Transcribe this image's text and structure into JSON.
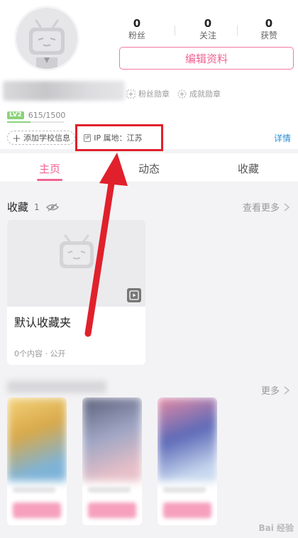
{
  "stats": [
    {
      "value": "0",
      "label": "粉丝"
    },
    {
      "value": "0",
      "label": "关注"
    },
    {
      "value": "0",
      "label": "获赞"
    }
  ],
  "edit_profile_label": "编辑资料",
  "medals": {
    "fans": "粉丝勋章",
    "achievements": "成就勋章"
  },
  "level": {
    "badge": "LV2",
    "exp": "615/1500",
    "progress": 0.41
  },
  "school_tag": "添加学校信息",
  "ip": {
    "icon_text": "IP",
    "label": "IP 属地：江苏"
  },
  "detail_link": "详情",
  "tabs": [
    {
      "label": "主页",
      "active": true
    },
    {
      "label": "动态",
      "active": false
    },
    {
      "label": "收藏",
      "active": false
    }
  ],
  "favorites": {
    "title": "收藏",
    "count": "1",
    "see_more": "查看更多",
    "card": {
      "name": "默认收藏夹",
      "meta": "0个内容 · 公开"
    }
  },
  "second_section": {
    "more": "更多"
  },
  "watermark": "Bai 经验",
  "colors": {
    "accent": "#f06292",
    "link": "#2a8fd4",
    "highlight": "#e0212c",
    "level": "#8bd27a"
  }
}
